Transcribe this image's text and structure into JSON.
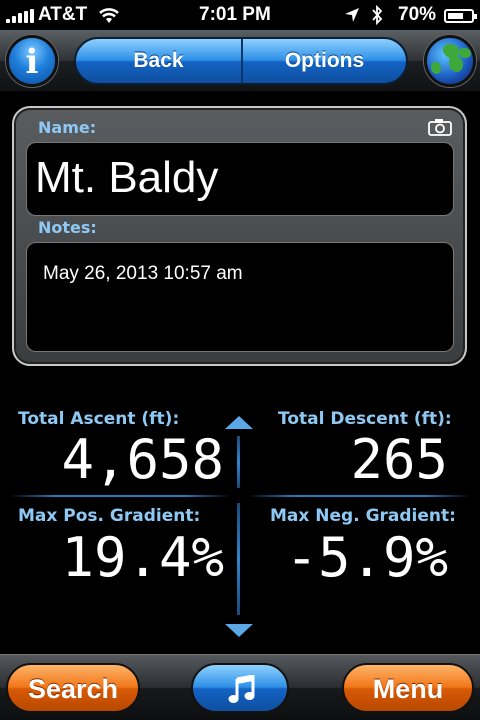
{
  "status_bar": {
    "carrier": "AT&T",
    "time": "7:01 PM",
    "battery_percent": "70%",
    "battery_level": 0.7,
    "icons": [
      "signal-icon",
      "wifi-icon",
      "location-arrow-icon",
      "bluetooth-icon",
      "battery-icon"
    ]
  },
  "toolbar": {
    "info_glyph": "i",
    "back_label": "Back",
    "options_label": "Options",
    "accent_blue": "#2e8fe6"
  },
  "panel": {
    "name_label": "Name:",
    "name_value": "Mt. Baldy",
    "notes_label": "Notes:",
    "notes_value": "May 26, 2013 10:57 am"
  },
  "stats": {
    "total_ascent_label": "Total Ascent (ft):",
    "total_ascent_value": "4,658",
    "total_descent_label": "Total Descent (ft):",
    "total_descent_value": "265",
    "max_pos_gradient_label": "Max Pos. Gradient:",
    "max_pos_gradient_value": "19.4%",
    "max_neg_gradient_label": "Max Neg. Gradient:",
    "max_neg_gradient_value": "-5.9%",
    "label_color": "#8ec9f5"
  },
  "bottom_bar": {
    "search_label": "Search",
    "menu_label": "Menu",
    "button_color": "#f07618"
  }
}
